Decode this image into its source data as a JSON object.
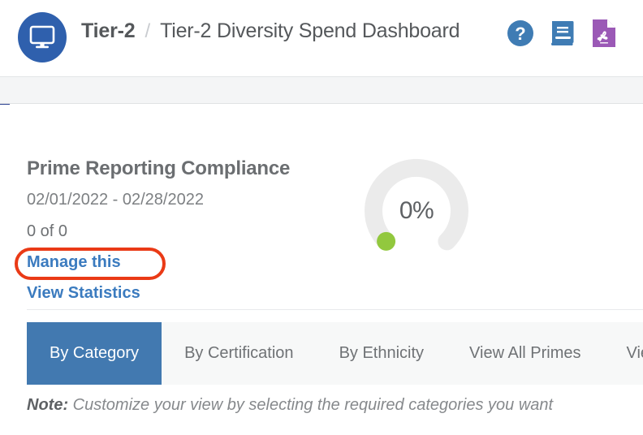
{
  "header": {
    "logo_icon": "monitor-icon",
    "breadcrumb": {
      "root": "Tier-2",
      "separator": "/",
      "current": "Tier-2 Diversity Spend Dashboard"
    },
    "icons": [
      {
        "name": "help-icon",
        "label": "?",
        "color": "#3f7cb4"
      },
      {
        "name": "manual-book-icon",
        "label": "",
        "color": "#3f7cb4"
      },
      {
        "name": "pdf-export-icon",
        "label": "",
        "color": "#9b59b6"
      }
    ]
  },
  "summary": {
    "title": "Prime Reporting Compliance",
    "date_range": "02/01/2022 - 02/28/2022",
    "count": "0 of 0",
    "manage_link": "Manage this",
    "stats_link": "View Statistics",
    "annotation_color": "#ea3a16"
  },
  "gauge": {
    "value_label": "0%",
    "percent": 0,
    "track_color": "#ebebeb",
    "marker_color": "#92c83e"
  },
  "tabs": [
    {
      "label": "By Category",
      "active": true
    },
    {
      "label": "By Certification",
      "active": false
    },
    {
      "label": "By Ethnicity",
      "active": false
    },
    {
      "label": "View All Primes",
      "active": false
    },
    {
      "label": "View Y",
      "active": false
    }
  ],
  "note": {
    "label": "Note:",
    "text": "Customize your view by selecting the required categories you want"
  },
  "colors": {
    "accent_blue": "#4279b0",
    "link_blue": "#3b7bbf",
    "rail_navy": "#2b4191",
    "logo_blue": "#2f60ad",
    "toolbar_gray": "#f4f5f6",
    "tabbar_gray": "#f7f8f8"
  }
}
